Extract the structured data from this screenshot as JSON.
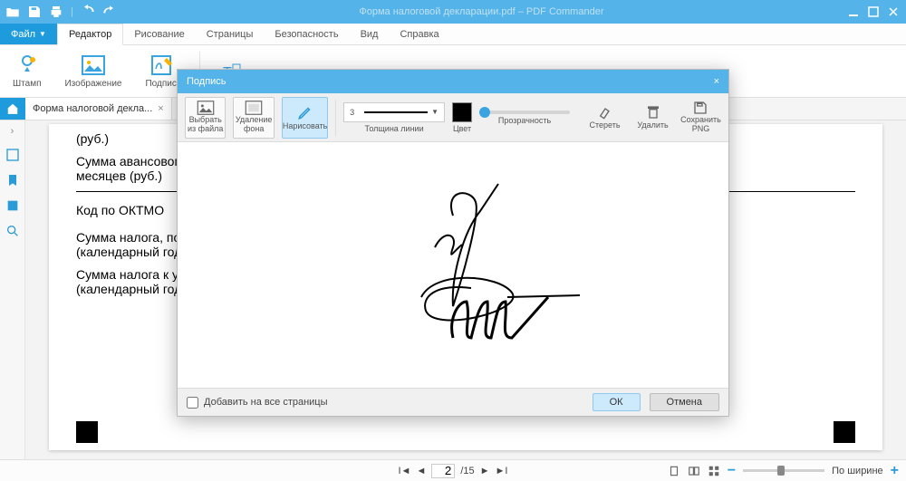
{
  "titlebar": {
    "title": "Форма налоговой декларации.pdf – PDF Commander"
  },
  "menu": {
    "file": "Файл",
    "items": [
      "Редактор",
      "Рисование",
      "Страницы",
      "Безопасность",
      "Вид",
      "Справка"
    ],
    "active_index": 0
  },
  "ribbon": {
    "stamp": "Штамп",
    "image": "Изображение",
    "sign": "Подпись"
  },
  "tab": {
    "label": "Форма налоговой декла..."
  },
  "doc": {
    "line1": "(руб.)",
    "line2": "Сумма авансового п",
    "line2b": "месяцев (руб.)",
    "line3": "Код по ОКТМО",
    "line4": "Сумма налога, подл",
    "line4b": "(календарный год) (р",
    "line5": "Сумма налога к умен",
    "line5b": "(календарный год) (р"
  },
  "dialog": {
    "title": "Подпись",
    "chooseFile": "Выбрать\nиз файла",
    "removeBg": "Удаление\nфона",
    "draw": "Нарисовать",
    "lineThickness": "3",
    "lineLabel": "Толщина линии",
    "colorLabel": "Цвет",
    "opacityLabel": "Прозрачность",
    "erase": "Стереть",
    "delete": "Удалить",
    "savePng": "Сохранить\nPNG",
    "addAll": "Добавить на все страницы",
    "ok": "ОК",
    "cancel": "Отмена"
  },
  "status": {
    "page": "2",
    "totalPages": "/15",
    "fit": "По ширине"
  }
}
